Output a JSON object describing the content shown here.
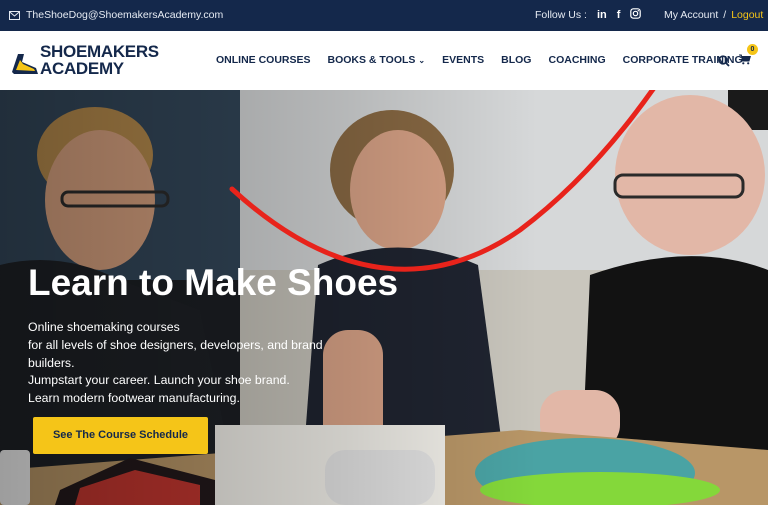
{
  "topbar": {
    "email": "TheShoeDog@ShoemakersAcademy.com",
    "follow_label": "Follow Us :",
    "social": [
      "in",
      "f",
      "ig"
    ],
    "my_account": "My Account",
    "separator": "/",
    "logout": "Logout"
  },
  "logo": {
    "line1": "SHOEMAKERS",
    "line2": "ACADEMY"
  },
  "nav": {
    "items": [
      "ONLINE COURSES",
      "BOOKS & TOOLS",
      "EVENTS",
      "BLOG",
      "COACHING",
      "CORPORATE TRAINING"
    ]
  },
  "header_icons": {
    "search": "search-icon",
    "cart": "cart-icon",
    "cart_count": "0"
  },
  "hero": {
    "title": "Learn to Make Shoes",
    "lines": [
      "Online shoemaking courses",
      "for all levels of shoe designers, developers, and brand builders.",
      "Jumpstart your career. Launch your shoe brand.",
      "Learn modern footwear manufacturing."
    ],
    "cta": "See The Course Schedule"
  },
  "colors": {
    "navy": "#14284b",
    "accent": "#f5c518",
    "annotation_arrow": "#e8231b"
  }
}
